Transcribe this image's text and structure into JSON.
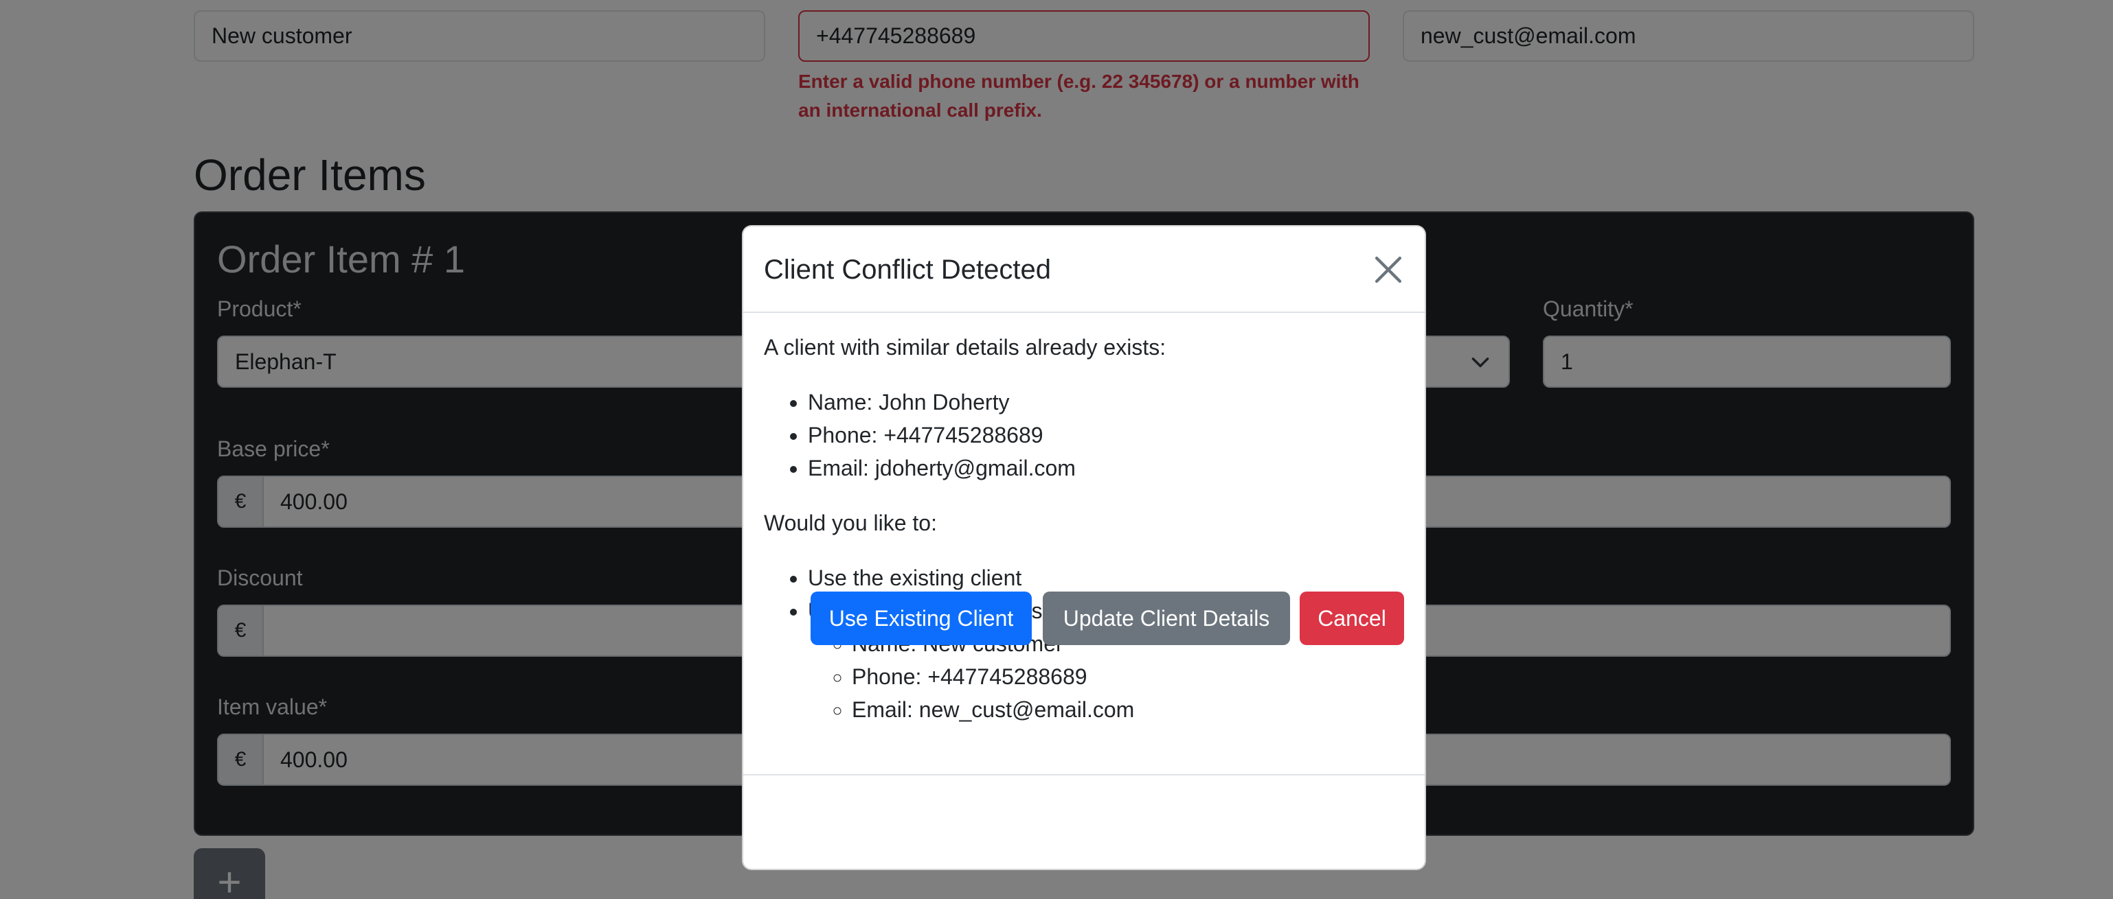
{
  "client": {
    "name_value": "New customer",
    "phone_value": "+447745288689",
    "email_value": "new_cust@email.com",
    "phone_error": "Enter a valid phone number (e.g. 22 345678) or a number with an international call prefix."
  },
  "order_items": {
    "title": "Order Items",
    "item": {
      "title": "Order Item # 1",
      "product_label": "Product*",
      "product_value": "Elephan-T",
      "quantity_label": "Quantity*",
      "quantity_value": "1",
      "base_price_label": "Base price*",
      "base_price_value": "400.00",
      "discount_label": "Discount",
      "discount_value": "",
      "item_value_label": "Item value*",
      "item_value_value": "400.00",
      "currency_symbol": "€"
    },
    "add_button_label": "+"
  },
  "modal": {
    "title": "Client Conflict Detected",
    "intro": "A client with similar details already exists:",
    "existing": [
      "Name: John Doherty",
      "Phone: +447745288689",
      "Email: jdoherty@gmail.com"
    ],
    "question": "Would you like to:",
    "option_use": "Use the existing client",
    "option_update": "Update the client details to:",
    "new_details": [
      "Name: New customer",
      "Phone: +447745288689",
      "Email: new_cust@email.com"
    ],
    "buttons": {
      "use_existing": "Use Existing Client",
      "update_details": "Update Client Details",
      "cancel": "Cancel"
    }
  },
  "colors": {
    "primary": "#0d6efd",
    "secondary": "#6c757d",
    "danger": "#dc3545",
    "card_dark": "#212529"
  },
  "icons": {
    "close": "close-icon",
    "chevron": "chevron-down-icon",
    "add": "plus-icon"
  }
}
